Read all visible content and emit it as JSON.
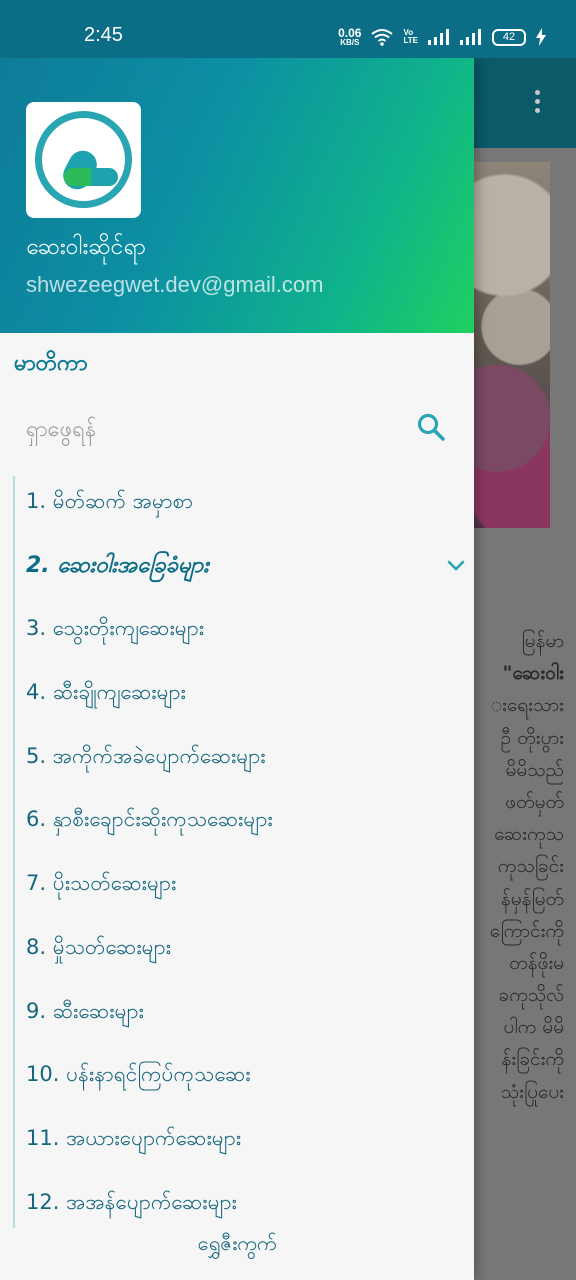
{
  "status_bar": {
    "time": "2:45",
    "net_speed_value": "0.06",
    "net_speed_unit": "KB/S",
    "volte_top": "Vo",
    "volte_bottom": "LTE",
    "battery": "42"
  },
  "drawer": {
    "app_name": "ဆေးဝါးဆိုင်ရာ",
    "email": "shwezeegwet.dev@gmail.com",
    "toc_title": "မာတိကာ",
    "search_placeholder": "ရှာဖွေရန်",
    "items": [
      {
        "label": "1. မိတ်ဆက် အမှာစာ"
      },
      {
        "label": "2. ဆေးဝါးအခြေခံများ"
      },
      {
        "label": "3. သွေးတိုးကျဆေးများ"
      },
      {
        "label": "4. ဆီးချိုကျဆေးများ"
      },
      {
        "label": "5. အကိုက်အခဲပျောက်ဆေးများ"
      },
      {
        "label": "6. နှာစီးချောင်းဆိုးကုသဆေးများ"
      },
      {
        "label": "7. ပိုးသတ်ဆေးများ"
      },
      {
        "label": "8. မှိုသတ်ဆေးများ"
      },
      {
        "label": "9. ဆီးဆေးများ"
      },
      {
        "label": "10. ပန်းနာရင်ကြပ်ကုသဆေး"
      },
      {
        "label": "11. အယားပျောက်ဆေးများ"
      },
      {
        "label": "12. အအန်ပျောက်ဆေးများ"
      }
    ],
    "active_index": 1,
    "footer_label": "ရွှေဇီးကွက်"
  },
  "background_text": [
    "မြန်မာ",
    "\"ဆေးဝါး",
    "းရေးသား",
    "ဦ တိုးပွား",
    "မိမိသည်",
    "ဖတ်မှတ်",
    "ဆေးကုသ",
    "ကုသခြင်း",
    "န်မှန်မြတ်",
    "ကြောင်းကို",
    "တန်ဖိုးမ",
    "ခကုသိုလ်",
    "ပါက မိမိ",
    "န်းခြင်းကို",
    "သုံးပြုပေး"
  ],
  "colors": {
    "status_bar": "#0b6e86",
    "accent": "#0c7a93",
    "header_gradient_start": "#0e7c99",
    "header_gradient_end": "#1fd05f"
  }
}
